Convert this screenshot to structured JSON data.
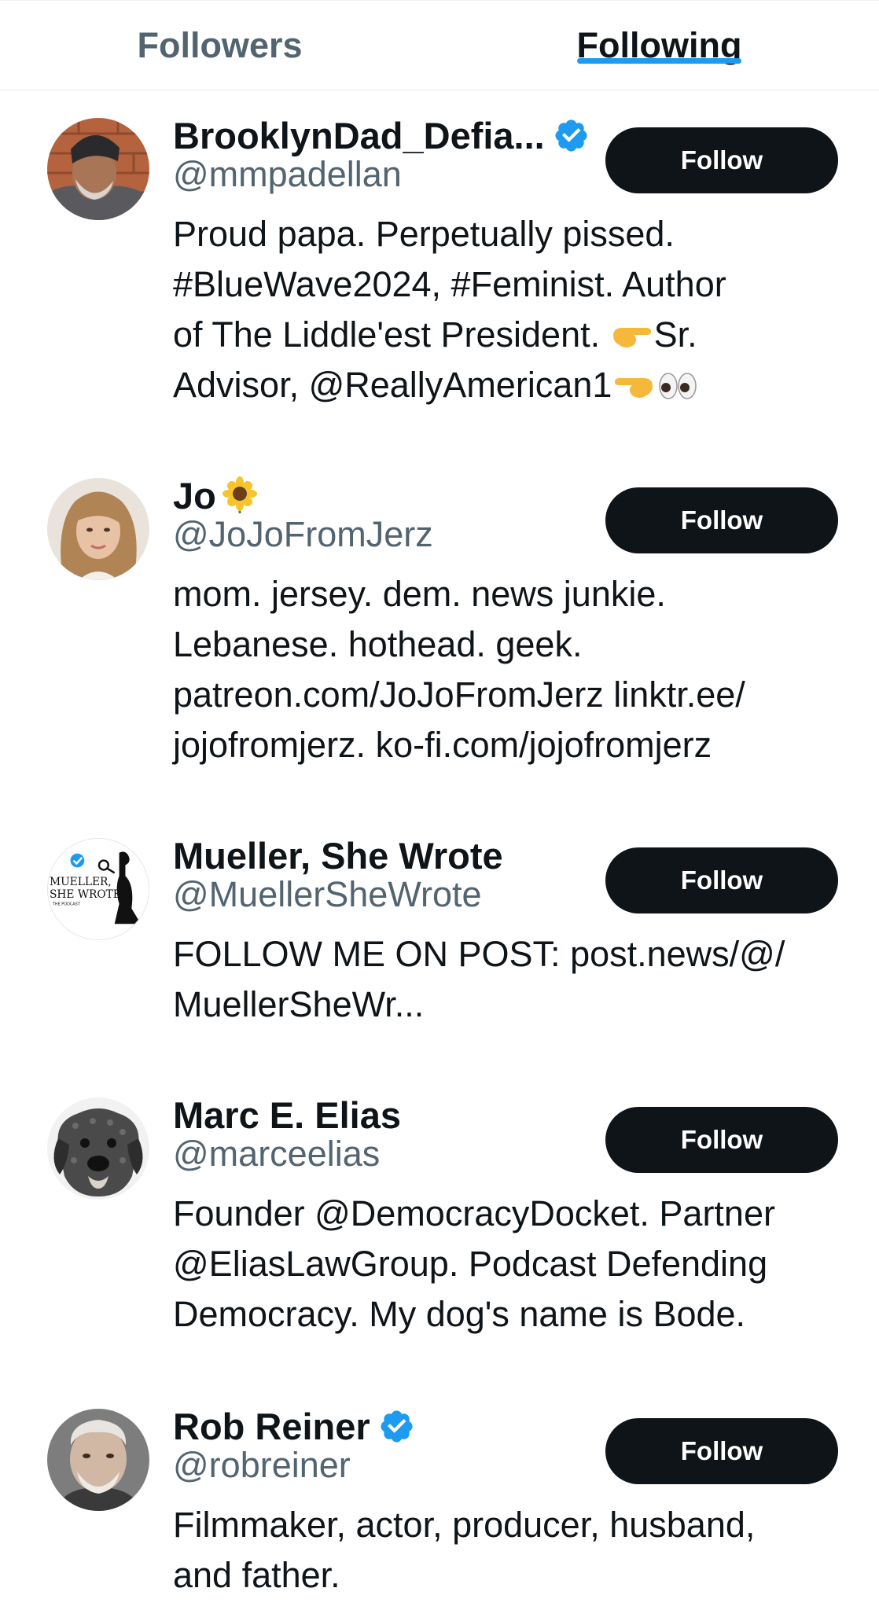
{
  "tabs": {
    "followers_label": "Followers",
    "following_label": "Following",
    "active": "Following"
  },
  "colors": {
    "accent": "#1d9bf0",
    "text_primary": "#0f1419",
    "text_secondary": "#536471",
    "button_bg": "#0f1419",
    "button_text": "#ffffff"
  },
  "users": [
    {
      "display_name": "BrooklynDad_Defia...",
      "verified": true,
      "handle": "@mmpadellan",
      "bio_lines": [
        "Proud papa. Perpetually pissed.",
        "#BlueWave2024, #Feminist. Author",
        "of The Liddle'est President.",
        "Advisor, @ReallyAmerican1"
      ],
      "bio_line3_suffix": "Sr.",
      "follow_label": "Follow",
      "avatar_icon": "man-in-beanie-avatar"
    },
    {
      "display_name": "Jo",
      "name_emoji": "sunflower",
      "verified": false,
      "handle": "@JoJoFromJerz",
      "bio_lines": [
        "mom. jersey. dem. news junkie.",
        "Lebanese. hothead. geek.",
        "patreon.com/JoJoFromJerz linktr.ee/",
        "jojofromjerz. ko-fi.com/jojofromjerz"
      ],
      "follow_label": "Follow",
      "avatar_icon": "woman-avatar"
    },
    {
      "display_name": "Mueller, She Wrote",
      "verified": false,
      "handle": "@MuellerSheWrote",
      "bio_lines": [
        "FOLLOW ME ON POST: post.news/@/",
        "MuellerSheWr..."
      ],
      "follow_label": "Follow",
      "avatar_icon": "podcast-logo-avatar",
      "avatar_text": {
        "line1": "MUELLER,",
        "line2": "SHE WROTE",
        "line3": "THE PODCAST"
      }
    },
    {
      "display_name": "Marc E. Elias",
      "verified": false,
      "handle": "@marceelias",
      "bio_lines": [
        "Founder @DemocracyDocket. Partner",
        "@EliasLawGroup. Podcast Defending",
        "Democracy. My dog's name is Bode."
      ],
      "follow_label": "Follow",
      "avatar_icon": "dog-avatar"
    },
    {
      "display_name": "Rob Reiner",
      "verified": true,
      "handle": "@robreiner",
      "bio_lines": [
        "Filmmaker, actor, producer, husband,",
        "and father."
      ],
      "follow_label": "Follow",
      "avatar_icon": "man-portrait-avatar"
    }
  ]
}
